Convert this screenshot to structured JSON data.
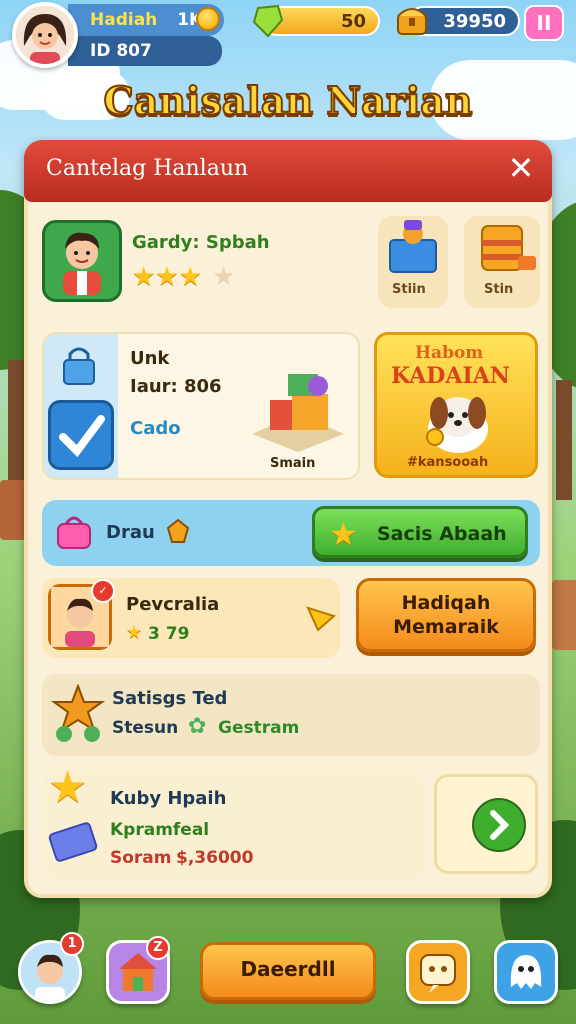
{
  "hud": {
    "player_name": "Hadiah",
    "player_name_count": "1K",
    "player_id": "ID 807",
    "energy_value": "50",
    "gems_value": "39950",
    "pause_label": "II"
  },
  "title": "Canisalan Narian",
  "panel": {
    "header_title": "Cantelag Hanlaun",
    "close_label": "✕",
    "profile": {
      "name": "Gardy: Spbah",
      "stars": "★★★",
      "items": [
        "Stiin",
        "Stin"
      ]
    },
    "unlock": {
      "label": "Unk",
      "value": "Iaur: 806",
      "check_label": "Cado",
      "stack_label": "Smain"
    },
    "promo": {
      "line1": "Habom",
      "line2": "KADAIAN",
      "footer": "#kansooah"
    },
    "draw": {
      "label": "Drau",
      "button": "Sacis Abaah"
    },
    "friend": {
      "name": "Pevcralia",
      "stat": "3 79",
      "button_line1": "Hadiqah",
      "button_line2": "Memaraik"
    },
    "settings": {
      "title": "Satisgs Ted",
      "line": "Stesun",
      "extra": "Gestram"
    },
    "reward": {
      "title": "Kuby Hpaih",
      "subtitle": "Kpramfeal",
      "score_label": "Soram",
      "score_value": "$,36000"
    }
  },
  "bottom": {
    "profile_badge": "1",
    "shop_badge": "Z",
    "main_button": "Daeerdll"
  }
}
